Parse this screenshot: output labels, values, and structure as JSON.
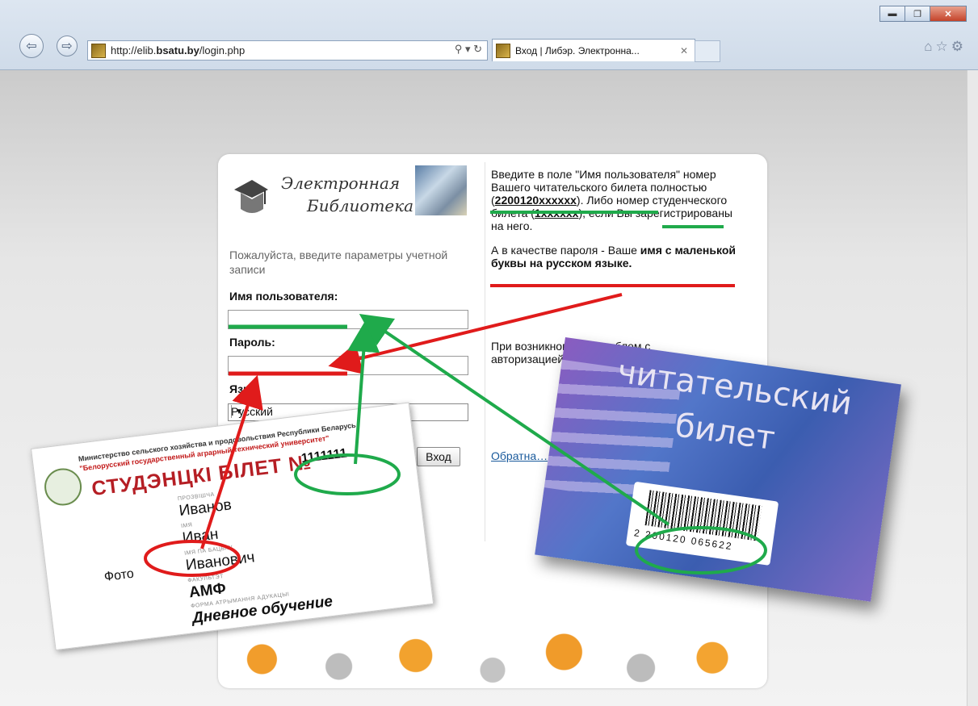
{
  "browser": {
    "url_prefix": "http://elib.",
    "url_domain": "bsatu.by",
    "url_path": "/login.php",
    "search_tools": "⚲ ▾ ↻",
    "tab_title": "Вход | Либэр. Электронна...",
    "tab_close": "✕",
    "window_buttons": {
      "minimize": "▬",
      "maximize": "❐",
      "close": "✕"
    },
    "icons": [
      "home-icon",
      "star-icon",
      "gear-icon"
    ]
  },
  "logo": {
    "line1": "Электронная",
    "line2": "Библиотека"
  },
  "login": {
    "prompt": "Пожалуйста, введите параметры учетной записи",
    "username_label": "Имя пользователя:",
    "password_label": "Пароль:",
    "language_label": "Язык",
    "language_value": "Русский",
    "submit_label": "Вход"
  },
  "help": {
    "p1_a": "Введите в поле \"Имя пользователя\" номер Вашего читательского билета полностью (",
    "p1_code1": "2200120xxxxxx",
    "p1_b": "). Либо номер студенческого билета (",
    "p1_code2": "1xxxxxx",
    "p1_c": "), если Вы зарегистрированы на него.",
    "p2_a": "А в качестве пароля - Ваше ",
    "p2_bold": "имя с маленькой буквы на русском языке.",
    "problem": "При возникновении проблем с авторизацией … форму обратной св…",
    "feedback_link": "Обратна…"
  },
  "student_card": {
    "ministry": "Министерство сельского хозяйства и продовольствия Республики Беларусь",
    "university": "\"Белорусский государственный аграрный технический университет\"",
    "title": "СТУДЭНЦКІ БІЛЕТ №",
    "number": "1111111",
    "surname_caption": "ПРОЗВІШЧА",
    "surname": "Иванов",
    "name_caption": "ІМЯ",
    "name": "Иван",
    "patronymic_caption": "ІМЯ ПА БАЦЬКУ",
    "patronymic": "Иванович",
    "faculty_caption": "ФАКУЛЬТЭТ",
    "faculty": "АМФ",
    "form_caption": "ФОРМА АТРЫМАННЯ АДУКАЦЫІ",
    "form": "Дневное обучение",
    "photo": "Фото"
  },
  "library_card": {
    "line1": "читательский",
    "line2": "билет",
    "barcode_number": "2  200120  065622"
  },
  "colors": {
    "annotation_green": "#1faa4b",
    "annotation_red": "#e01b1b"
  }
}
